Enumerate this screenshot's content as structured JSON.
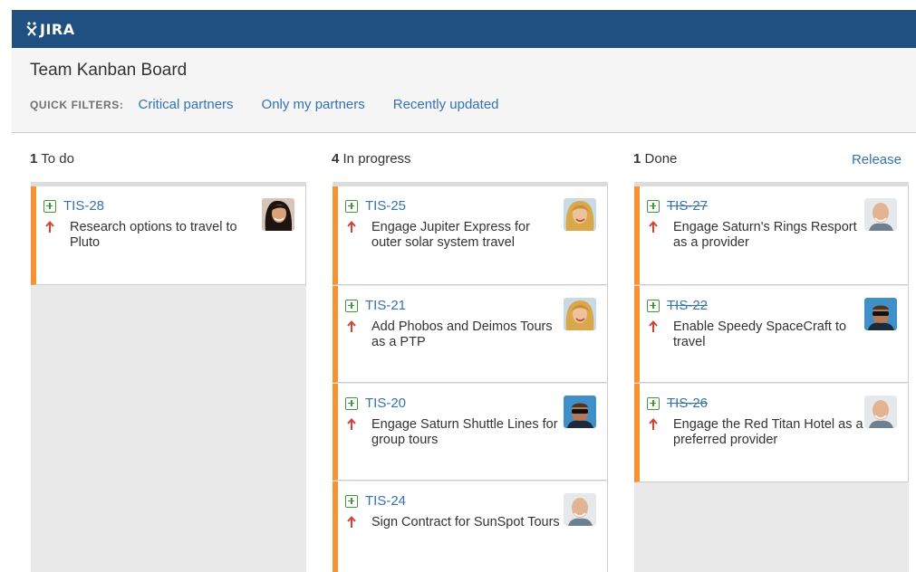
{
  "app": {
    "logo_text": "JIRA"
  },
  "board": {
    "title": "Team Kanban Board"
  },
  "quick_filters": {
    "label": "QUICK FILTERS:",
    "items": [
      "Critical partners",
      "Only my partners",
      "Recently updated"
    ]
  },
  "columns": [
    {
      "count": "1",
      "name": "To do",
      "cards": [
        {
          "key": "TIS-28",
          "summary": "Research options to travel to Pluto",
          "assignee_avatar": "avatar-woman-dark-hair",
          "priority": "major"
        }
      ]
    },
    {
      "count": "4",
      "name": "In progress",
      "cards": [
        {
          "key": "TIS-25",
          "summary": "Engage Jupiter Express for outer solar system travel",
          "assignee_avatar": "avatar-woman-blonde",
          "priority": "major"
        },
        {
          "key": "TIS-21",
          "summary": "Add Phobos and Deimos Tours as a PTP",
          "assignee_avatar": "avatar-woman-blonde",
          "priority": "major"
        },
        {
          "key": "TIS-20",
          "summary": "Engage Saturn Shuttle Lines for group tours",
          "assignee_avatar": "avatar-man-sunglasses",
          "priority": "major"
        },
        {
          "key": "TIS-24",
          "summary": "Sign Contract for SunSpot Tours",
          "assignee_avatar": "avatar-man-bald",
          "priority": "major"
        }
      ]
    },
    {
      "count": "1",
      "name": "Done",
      "action": "Release",
      "cards": [
        {
          "key": "TIS-27",
          "summary": "Engage Saturn's Rings Resport as a provider",
          "assignee_avatar": "avatar-man-bald",
          "priority": "major",
          "resolved": true
        },
        {
          "key": "TIS-22",
          "summary": "Enable Speedy SpaceCraft to travel",
          "assignee_avatar": "avatar-man-sunglasses",
          "priority": "major",
          "resolved": true
        },
        {
          "key": "TIS-26",
          "summary": "Engage the Red Titan Hotel as a preferred provider",
          "assignee_avatar": "avatar-man-bald",
          "priority": "major",
          "resolved": true
        }
      ]
    }
  ],
  "colors": {
    "header_bg": "#205081",
    "link": "#3572b0",
    "card_flag": "#f79232",
    "priority_up": "#d04437",
    "story_icon": "#3b9a36"
  }
}
